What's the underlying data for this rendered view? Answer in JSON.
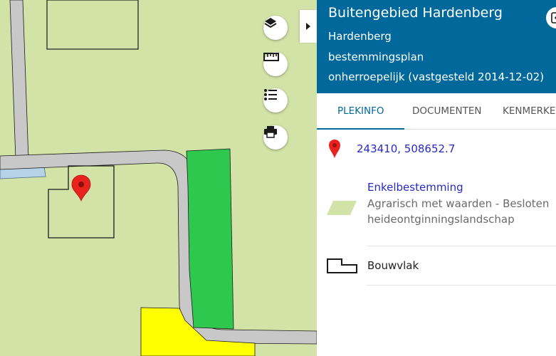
{
  "plan": {
    "title": "Buitengebied Hardenberg",
    "municipality": "Hardenberg",
    "type": "bestemmingsplan",
    "status": "onherroepelijk (vastgesteld 2014-12-02)"
  },
  "tabs": [
    {
      "label": "PLEKINFO",
      "active": true
    },
    {
      "label": "DOCUMENTEN",
      "active": false
    },
    {
      "label": "KENMERKEN",
      "active": false
    }
  ],
  "location": {
    "coordinates": "243410, 508652.7"
  },
  "enkelbestemming": {
    "title": "Enkelbestemming",
    "description": "Agrarisch met waarden - Besloten heideontginningslandschap",
    "swatch_color": "#d3e2a7"
  },
  "bouwvlak": {
    "label": "Bouwvlak"
  },
  "map_controls": [
    {
      "name": "layers-icon"
    },
    {
      "name": "ruler-icon"
    },
    {
      "name": "legend-list-icon"
    },
    {
      "name": "print-icon"
    }
  ],
  "colors": {
    "header_bg": "#01689b",
    "map_agrarisch": "#d3e2a7",
    "map_road": "#c8c8c8",
    "map_green": "#2dc84d",
    "map_yellow": "#ffff00",
    "map_water": "#b4d2e8",
    "marker": "#e8231e",
    "link": "#2929c7"
  }
}
